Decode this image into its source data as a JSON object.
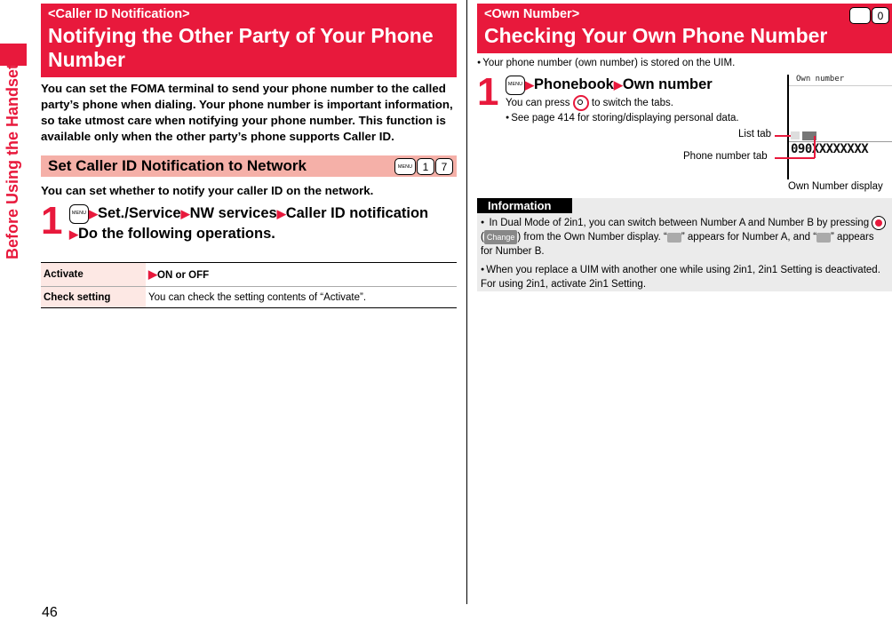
{
  "side_label": "Before Using the Handset",
  "page_number": "46",
  "left": {
    "category": "<Caller ID Notification>",
    "title": "Notifying the Other Party of Your Phone Number",
    "intro": "You can set the FOMA terminal to send your phone number to the called party’s phone when dialing. Your phone number is important information, so take utmost care when notifying your phone number. This function is available only when the other party’s phone supports Caller ID.",
    "section": {
      "title": "Set Caller ID Notification to Network",
      "shortcut_keys": [
        "MENU",
        "1",
        "7"
      ],
      "description": "You can set whether to notify your caller ID on the network.",
      "step": {
        "number": "1",
        "menu_key": "MENU",
        "path": [
          "Set./Service",
          "NW services",
          "Caller ID notification",
          "Do the following operations."
        ]
      },
      "operations": [
        {
          "key": "Activate",
          "value": "ON or OFF",
          "arrow": true
        },
        {
          "key": "Check setting",
          "value": "You can check the setting contents of “Activate”.",
          "arrow": false
        }
      ]
    }
  },
  "right": {
    "category": "<Own Number>",
    "title": "Checking Your Own Phone Number",
    "shortcut_keys": [
      "MENU",
      "0"
    ],
    "note": "Your phone number (own number) is stored on the UIM.",
    "step": {
      "number": "1",
      "menu_key": "MENU",
      "path": [
        "Phonebook",
        "Own number"
      ],
      "detail_before": "You can press",
      "detail_after": "to switch the tabs.",
      "bullet": "See page 414 for storing/displaying personal data."
    },
    "screen": {
      "title": "Own number",
      "number": "090XXXXXXXX",
      "caption": "Own Number display",
      "callouts": [
        "List tab",
        "Phone number tab"
      ]
    },
    "information": {
      "title": "Information",
      "items": [
        {
          "part1": "In Dual Mode of 2in1, you can switch between Number A and Number B by pressing",
          "softkey": "Change",
          "part2": ") from the Own Number display. “",
          "part3": "” appears for Number A, and “",
          "part4": "” appears for Number B."
        },
        {
          "text": "When you replace a UIM with another one while using 2in1, 2in1 Setting is deactivated. For using 2in1, activate 2in1 Setting."
        }
      ]
    }
  },
  "colors": {
    "accent": "#e8193c",
    "section_bg": "#f5b0a8",
    "table_key_bg": "#fde8e4",
    "info_bg": "#ebebeb"
  }
}
